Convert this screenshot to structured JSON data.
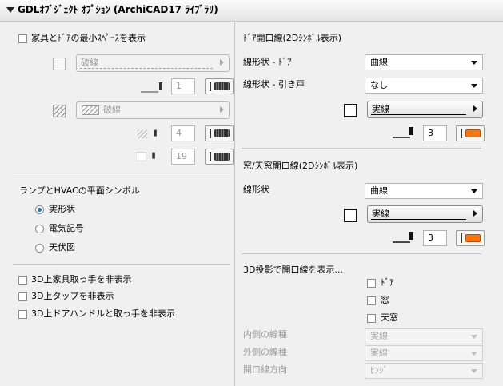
{
  "header": {
    "title": "GDLｵﾌﾞｼﾞｪｸﾄ ｵﾌﾟｼｮﾝ (ArchiCAD17 ﾗｲﾌﾞﾗﾘ)"
  },
  "left": {
    "min_space_label": "家具とﾄﾞｱの最小ｽﾍﾟｰｽを表示",
    "line1": {
      "linetype": "破線",
      "pen": "1"
    },
    "fill1": {
      "fill": "破線",
      "pen_fg": "4",
      "pen_bg": "19"
    },
    "lamp_title": "ランプとHVACの平面シンボル",
    "radio": [
      "実形状",
      "電気記号",
      "天伏図"
    ],
    "checks": [
      "3D上家具取っ手を非表示",
      "3D上タップを非表示",
      "3D上ドアハンドルと取っ手を非表示"
    ]
  },
  "right": {
    "door_title": "ﾄﾞｱ開口線(2Dｼﾝﾎﾞﾙ表示)",
    "door_shape_label": "線形状 - ﾄﾞｱ",
    "door_shape_value": "曲線",
    "sliding_label": "線形状 - 引き戸",
    "sliding_value": "なし",
    "door_linetype": "実線",
    "door_pen": "3",
    "window_title": "窓/天窓開口線(2Dｼﾝﾎﾞﾙ表示)",
    "window_shape_label": "線形状",
    "window_shape_value": "曲線",
    "window_linetype": "実線",
    "window_pen": "3",
    "proj_title": "3D投影で開口線を表示...",
    "proj_checks": [
      "ﾄﾞｱ",
      "窓",
      "天窓"
    ],
    "inner_label": "内側の線種",
    "inner_value": "実線",
    "outer_label": "外側の線種",
    "outer_value": "実線",
    "dir_label": "開口線方向",
    "dir_value": "ﾋﾝｼﾞ"
  }
}
